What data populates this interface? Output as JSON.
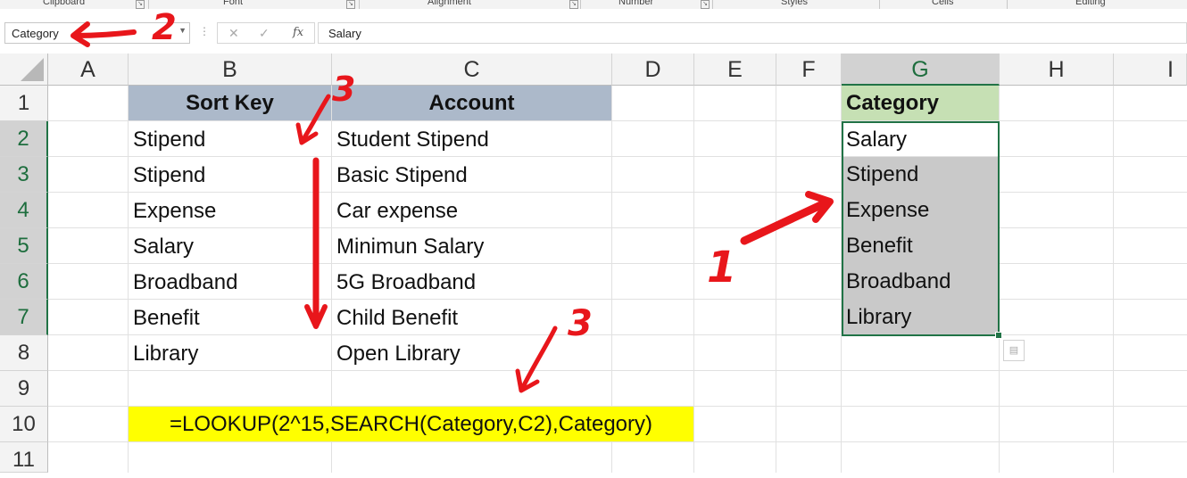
{
  "ribbon_groups": [
    "Clipboard",
    "Font",
    "Alignment",
    "Number",
    "Styles",
    "Cells",
    "Editing"
  ],
  "name_box": {
    "value": "Category"
  },
  "formula_bar": {
    "cancel_icon": "✕",
    "enter_icon": "✓",
    "fx_label": "fx",
    "content": "Salary"
  },
  "columns": [
    "A",
    "B",
    "C",
    "D",
    "E",
    "F",
    "G",
    "H",
    "I"
  ],
  "rows": [
    "1",
    "2",
    "3",
    "4",
    "5",
    "6",
    "7",
    "8",
    "9",
    "10",
    "11"
  ],
  "selected_column": "G",
  "cells": {
    "B1": "Sort Key",
    "C1": "Account",
    "G1": "Category",
    "B2": "Stipend",
    "C2": "Student Stipend",
    "G2": "Salary",
    "B3": "Stipend",
    "C3": "Basic Stipend",
    "G3": "Stipend",
    "B4": "Expense",
    "C4": "Car expense",
    "G4": "Expense",
    "B5": "Salary",
    "C5": "Minimun Salary",
    "G5": "Benefit",
    "B6": "Broadband",
    "C6": "5G Broadband",
    "G6": "Broadband",
    "B7": "Benefit",
    "C7": "Child Benefit",
    "G7": "Library",
    "B8": "Library",
    "C8": "Open Library",
    "B10": "=LOOKUP(2^15,SEARCH(Category,C2),Category)"
  },
  "annotations": {
    "num_1": "1",
    "num_2": "2",
    "num_3a": "3",
    "num_3b": "3",
    "color": "#e8161b"
  },
  "colors": {
    "header_blue": "#acb9ca",
    "header_green": "#c6e0b4",
    "formula_yellow": "#ffff00",
    "selection_green": "#217346"
  }
}
